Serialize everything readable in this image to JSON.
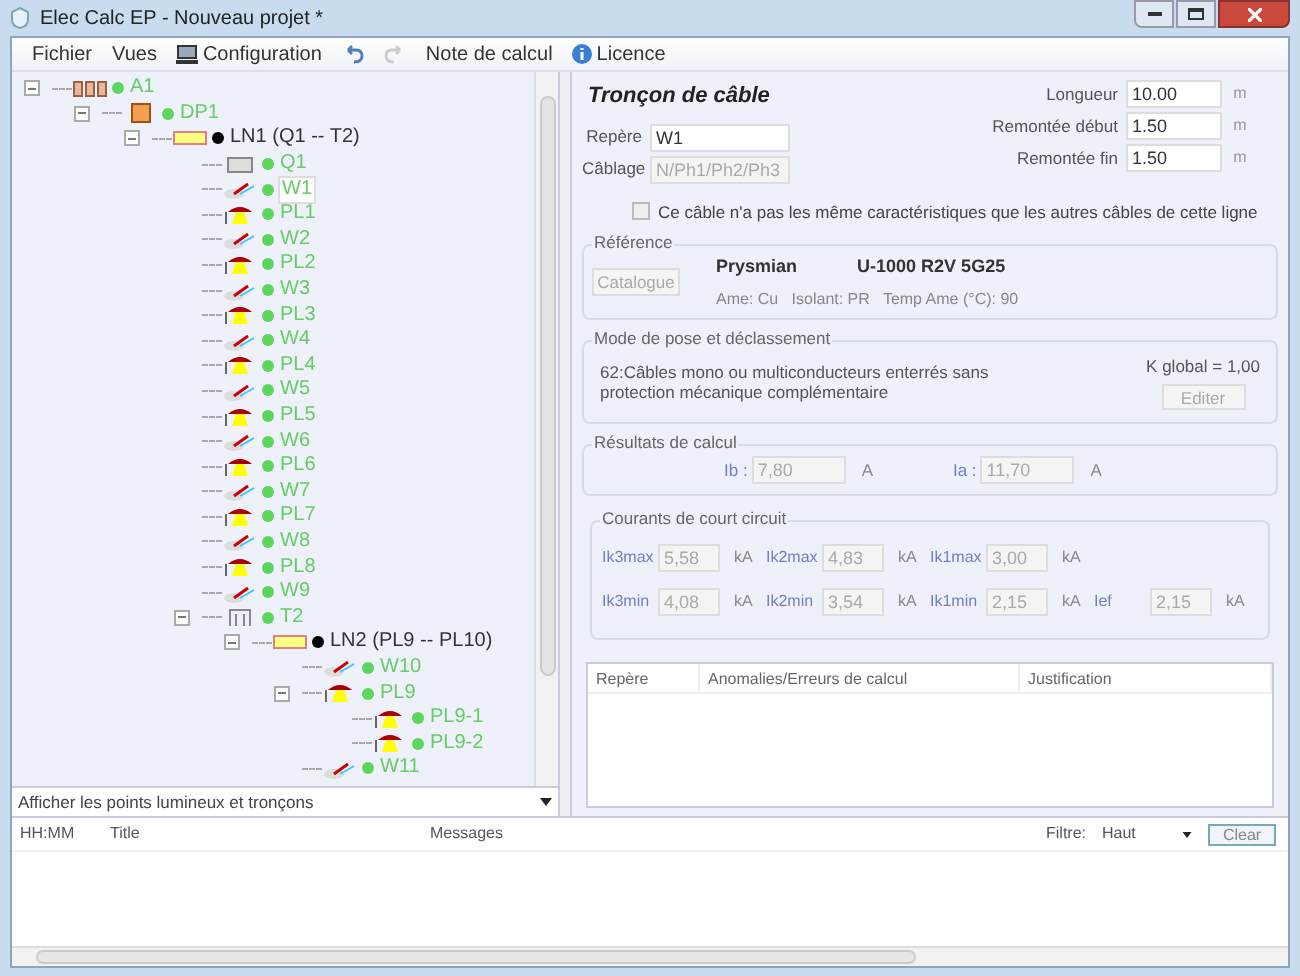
{
  "window": {
    "title": "Elec Calc EP - Nouveau projet *"
  },
  "menu": [
    {
      "kind": "text",
      "label": "Fichier"
    },
    {
      "kind": "text",
      "label": "Vues"
    },
    {
      "kind": "config",
      "label": "Configuration"
    },
    {
      "kind": "undo",
      "disabled": false
    },
    {
      "kind": "redo",
      "disabled": true
    },
    {
      "kind": "text",
      "label": "Note de calcul"
    },
    {
      "kind": "info",
      "label": "Licence"
    }
  ],
  "tree": [
    {
      "kind": "supply",
      "label": "A1",
      "color": "#5cd65c",
      "expanded": true,
      "selected": false,
      "children": [
        {
          "kind": "panel",
          "label": "DP1",
          "color": "#5cd65c",
          "expanded": true,
          "selected": false,
          "children": [
            {
              "kind": "line",
              "label": "LN1 (Q1 -- T2)",
              "color": "#000000",
              "expanded": true,
              "selected": false,
              "children": [
                {
                  "kind": "breaker",
                  "label": "Q1",
                  "color": "#5cd65c",
                  "selected": false
                },
                {
                  "kind": "cable",
                  "label": "W1",
                  "color": "#5cd65c",
                  "selected": true
                },
                {
                  "kind": "lamp",
                  "label": "PL1",
                  "color": "#5cd65c",
                  "selected": false
                },
                {
                  "kind": "cable",
                  "label": "W2",
                  "color": "#5cd65c",
                  "selected": false
                },
                {
                  "kind": "lamp",
                  "label": "PL2",
                  "color": "#5cd65c",
                  "selected": false
                },
                {
                  "kind": "cable",
                  "label": "W3",
                  "color": "#5cd65c",
                  "selected": false
                },
                {
                  "kind": "lamp",
                  "label": "PL3",
                  "color": "#5cd65c",
                  "selected": false
                },
                {
                  "kind": "cable",
                  "label": "W4",
                  "color": "#5cd65c",
                  "selected": false
                },
                {
                  "kind": "lamp",
                  "label": "PL4",
                  "color": "#5cd65c",
                  "selected": false
                },
                {
                  "kind": "cable",
                  "label": "W5",
                  "color": "#5cd65c",
                  "selected": false
                },
                {
                  "kind": "lamp",
                  "label": "PL5",
                  "color": "#5cd65c",
                  "selected": false
                },
                {
                  "kind": "cable",
                  "label": "W6",
                  "color": "#5cd65c",
                  "selected": false
                },
                {
                  "kind": "lamp",
                  "label": "PL6",
                  "color": "#5cd65c",
                  "selected": false
                },
                {
                  "kind": "cable",
                  "label": "W7",
                  "color": "#5cd65c",
                  "selected": false
                },
                {
                  "kind": "lamp",
                  "label": "PL7",
                  "color": "#5cd65c",
                  "selected": false
                },
                {
                  "kind": "cable",
                  "label": "W8",
                  "color": "#5cd65c",
                  "selected": false
                },
                {
                  "kind": "lamp",
                  "label": "PL8",
                  "color": "#5cd65c",
                  "selected": false
                },
                {
                  "kind": "cable",
                  "label": "W9",
                  "color": "#5cd65c",
                  "selected": false
                },
                {
                  "kind": "junction",
                  "label": "T2",
                  "color": "#5cd65c",
                  "expanded": true,
                  "selected": false,
                  "children": [
                    {
                      "kind": "line",
                      "label": "LN2 (PL9 -- PL10)",
                      "color": "#000000",
                      "expanded": true,
                      "selected": false,
                      "children": [
                        {
                          "kind": "cable",
                          "label": "W10",
                          "color": "#5cd65c",
                          "selected": false
                        },
                        {
                          "kind": "lamp",
                          "label": "PL9",
                          "color": "#5cd65c",
                          "expanded": true,
                          "selected": false,
                          "children": [
                            {
                              "kind": "lamp",
                              "label": "PL9-1",
                              "color": "#5cd65c",
                              "selected": false
                            },
                            {
                              "kind": "lamp",
                              "label": "PL9-2",
                              "color": "#5cd65c",
                              "selected": false
                            }
                          ]
                        },
                        {
                          "kind": "cable",
                          "label": "W11",
                          "color": "#5cd65c",
                          "selected": false
                        }
                      ]
                    }
                  ]
                }
              ]
            }
          ]
        }
      ]
    }
  ],
  "view_select": {
    "value": "Afficher les points lumineux et tronçons"
  },
  "section": {
    "title": "Tronçon de câble",
    "left_fields": [
      {
        "label": "Repère",
        "value": "W1",
        "disabled": false
      },
      {
        "label": "Câblage",
        "value": "N/Ph1/Ph2/Ph3",
        "disabled": true
      }
    ],
    "right_fields": [
      {
        "label": "Longueur",
        "value": "10.00",
        "unit": "m"
      },
      {
        "label": "Remontée début",
        "value": "1.50",
        "unit": "m"
      },
      {
        "label": "Remontée fin",
        "value": "1.50",
        "unit": "m"
      }
    ],
    "checkbox": {
      "label": "Ce câble n'a pas les même caractéristiques que les autres câbles de cette ligne",
      "checked": false
    }
  },
  "reference": {
    "title": "Référence",
    "button": "Catalogue",
    "brand": "Prysmian",
    "model": "U-1000 R2V 5G25",
    "details": "Ame: Cu   Isolant: PR   Temp Ame (°C): 90"
  },
  "mode_pose": {
    "title": "Mode de pose et déclassement",
    "description": "62:Câbles mono ou multiconducteurs enterrés sans protection mécanique complémentaire",
    "k_global": "K global = 1,00",
    "button": "Editer"
  },
  "results": {
    "title": "Résultats de calcul",
    "fields": [
      {
        "label": "Ib :",
        "value": "7,80",
        "unit": "A"
      },
      {
        "label": "Ia :",
        "value": "11,70",
        "unit": "A"
      }
    ]
  },
  "short_circuit": {
    "title": "Courants de court circuit",
    "rows": [
      [
        {
          "label": "Ik3max",
          "value": "5,58",
          "unit": "kA"
        },
        {
          "label": "Ik2max",
          "value": "4,83",
          "unit": "kA"
        },
        {
          "label": "Ik1max",
          "value": "3,00",
          "unit": "kA"
        }
      ],
      [
        {
          "label": "Ik3min",
          "value": "4,08",
          "unit": "kA"
        },
        {
          "label": "Ik2min",
          "value": "3,54",
          "unit": "kA"
        },
        {
          "label": "Ik1min",
          "value": "2,15",
          "unit": "kA"
        },
        {
          "label": "Ief",
          "value": "2,15",
          "unit": "kA"
        }
      ]
    ]
  },
  "anomalies": {
    "columns": [
      "Repère",
      "Anomalies/Erreurs de calcul",
      "Justification"
    ]
  },
  "log": {
    "columns": [
      "HH:MM",
      "Title",
      "Messages"
    ],
    "filter_label": "Filtre:",
    "filter_value": "Haut",
    "button": "Clear"
  }
}
